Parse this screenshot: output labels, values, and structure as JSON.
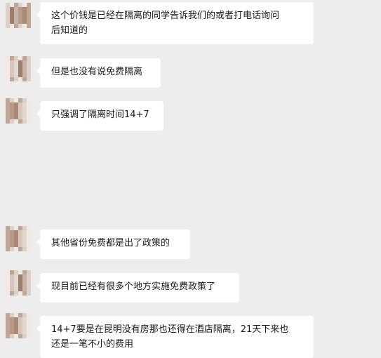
{
  "messages": [
    {
      "lines": [
        "这个价钱是已经在隔离的同学告诉我们的或者打电话询问",
        "后知道的"
      ]
    },
    {
      "lines": [
        "但是也没有说免费隔离"
      ]
    },
    {
      "lines": [
        "只强调了隔离时间14+7"
      ]
    },
    {
      "lines": [
        "其他省份免费都是出了政策的"
      ]
    },
    {
      "lines": [
        "现目前已经有很多个地方实施免费政策了"
      ]
    },
    {
      "lines": [
        "14+7要是在昆明没有房那也还得在酒店隔离，21天下来也",
        "还是一笔不小的费用"
      ]
    }
  ],
  "colors": {
    "background": "#ededed",
    "bubble": "#ffffff",
    "text": "#191919"
  }
}
